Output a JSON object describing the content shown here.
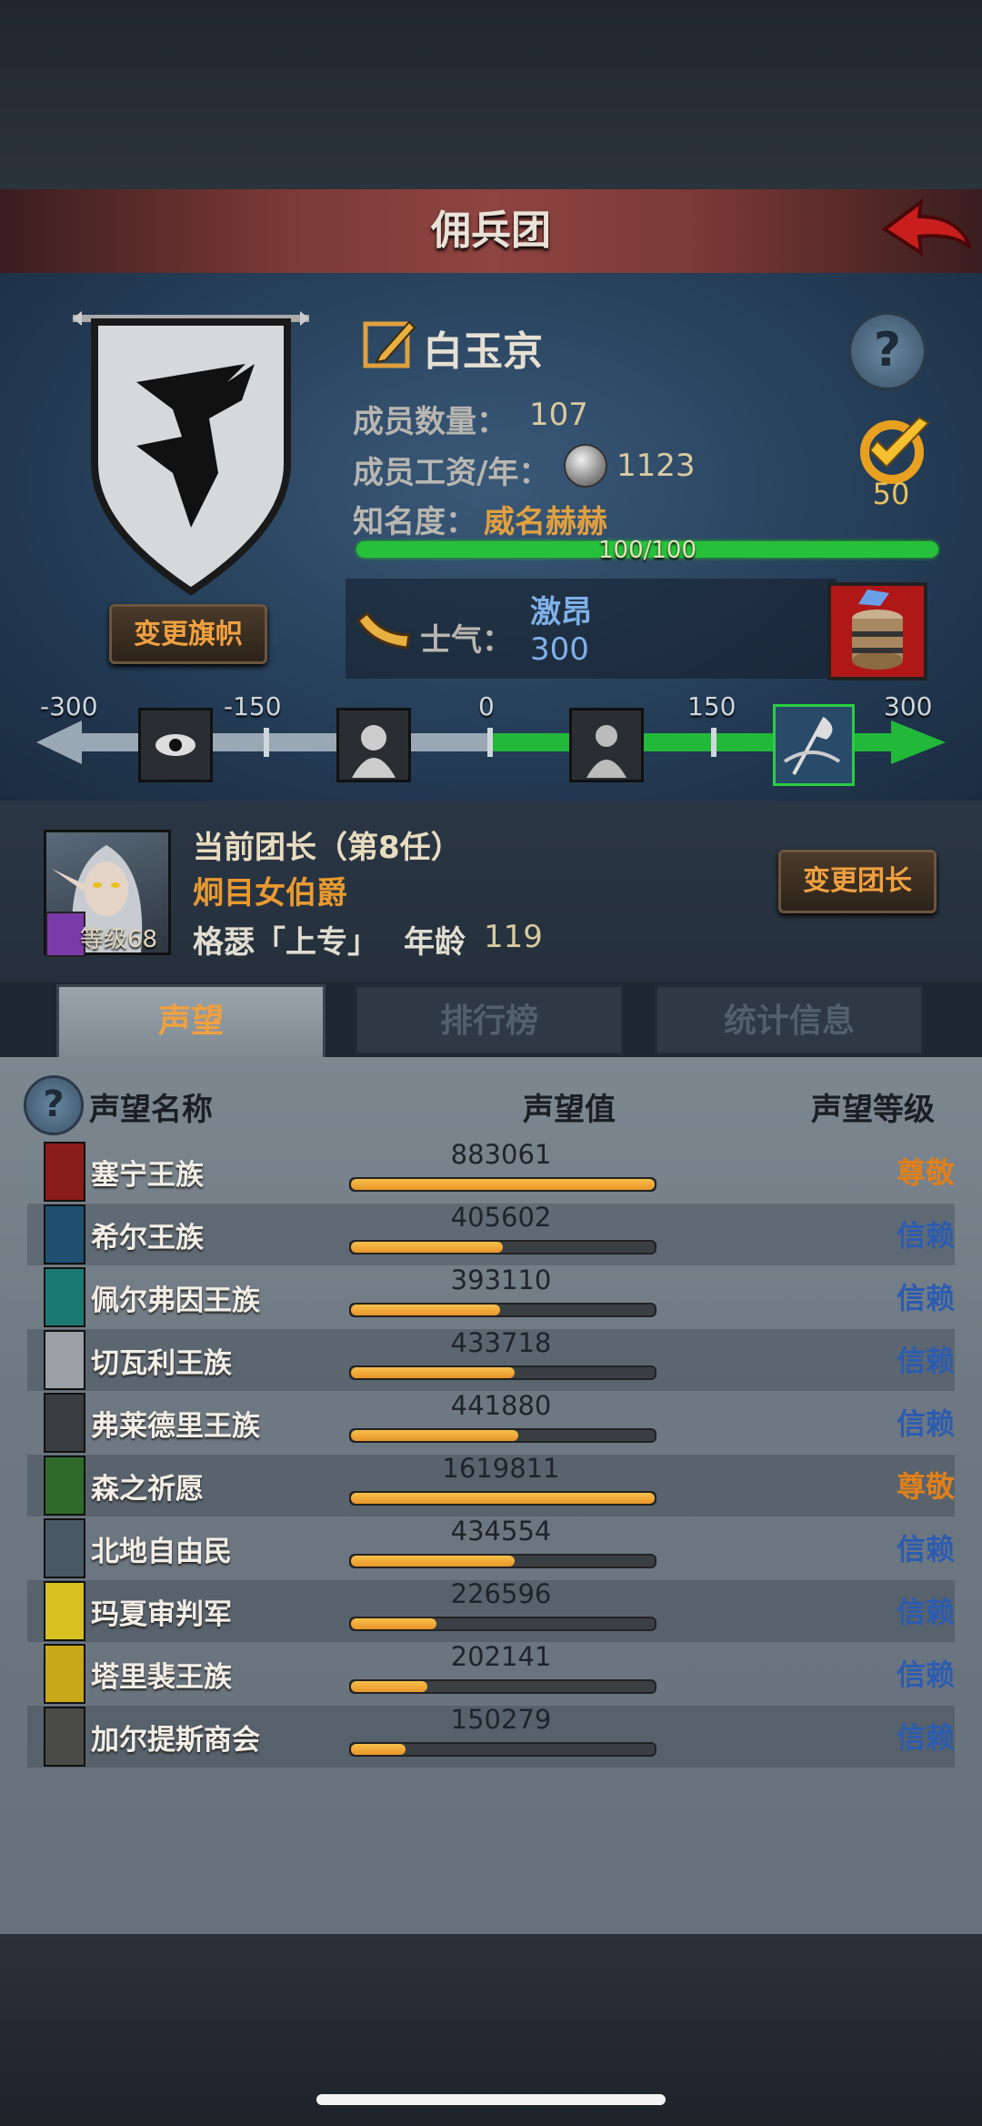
{
  "header": {
    "title": "佣兵团"
  },
  "clan": {
    "name": "白玉京",
    "member_count_label": "成员数量：",
    "member_count": "107",
    "salary_label": "成员工资/年：",
    "salary": "1123",
    "fame_label": "知名度：",
    "fame_title": "威名赫赫",
    "fame_progress_text": "100/100",
    "fame_progress": 1.0,
    "achievement_count": "50",
    "change_banner_label": "变更旗帜"
  },
  "morale": {
    "label": "士气：",
    "state": "激昂",
    "value": "300",
    "ticks": [
      "-300",
      "-150",
      "0",
      "150",
      "300"
    ]
  },
  "leader": {
    "title": "当前团长（第8任）",
    "name": "炯目女伯爵",
    "level_label": "等级68",
    "class_label": "格瑟「上专」",
    "age_label": "年龄",
    "age": "119",
    "change_leader_label": "变更团长"
  },
  "tabs": [
    {
      "label": "声望",
      "active": true
    },
    {
      "label": "排行榜",
      "active": false
    },
    {
      "label": "统计信息",
      "active": false
    }
  ],
  "table_header": {
    "name": "声望名称",
    "value": "声望值",
    "level": "声望等级"
  },
  "rows": [
    {
      "name": "塞宁王族",
      "value": "883061",
      "fill": 1.0,
      "level": "尊敬",
      "icon_color": "#8a1c1c"
    },
    {
      "name": "希尔王族",
      "value": "405602",
      "fill": 0.5,
      "level": "信赖",
      "icon_color": "#1e4f6e"
    },
    {
      "name": "佩尔弗因王族",
      "value": "393110",
      "fill": 0.49,
      "level": "信赖",
      "icon_color": "#1a7a72"
    },
    {
      "name": "切瓦利王族",
      "value": "433718",
      "fill": 0.54,
      "level": "信赖",
      "icon_color": "#9aa0a6"
    },
    {
      "name": "弗莱德里王族",
      "value": "441880",
      "fill": 0.55,
      "level": "信赖",
      "icon_color": "#3a3d40"
    },
    {
      "name": "森之祈愿",
      "value": "1619811",
      "fill": 1.0,
      "level": "尊敬",
      "icon_color": "#2f6a2a"
    },
    {
      "name": "北地自由民",
      "value": "434554",
      "fill": 0.54,
      "level": "信赖",
      "icon_color": "#4a5864"
    },
    {
      "name": "玛夏审判军",
      "value": "226596",
      "fill": 0.28,
      "level": "信赖",
      "icon_color": "#d8c020"
    },
    {
      "name": "塔里裴王族",
      "value": "202141",
      "fill": 0.25,
      "level": "信赖",
      "icon_color": "#c8a818"
    },
    {
      "name": "加尔提斯商会",
      "value": "150279",
      "fill": 0.18,
      "level": "信赖",
      "icon_color": "#4a4a46"
    }
  ],
  "colors": {
    "level_respect": "#e0801c",
    "level_trust": "#2c5cb0",
    "accent": "#f0a040"
  }
}
